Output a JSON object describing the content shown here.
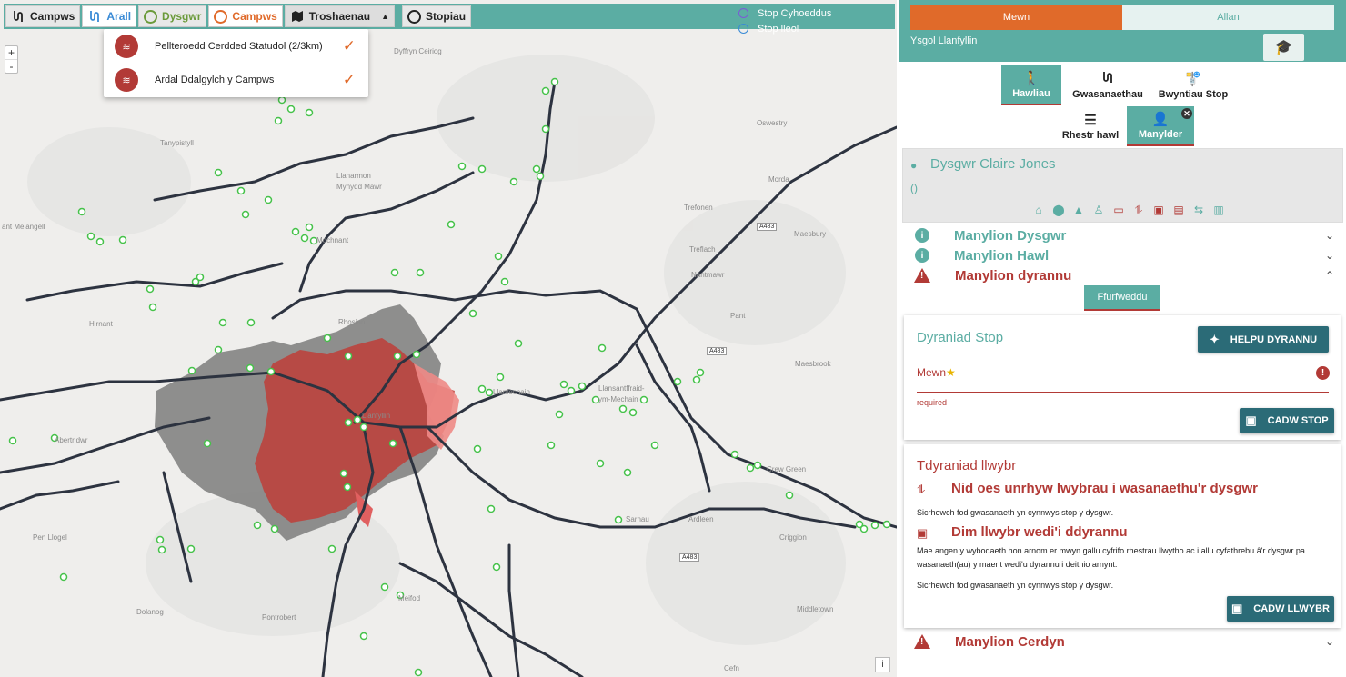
{
  "toolbar": {
    "campws": "Campws",
    "arall": "Arall",
    "dysgwr": "Dysgwr",
    "campws2": "Campws",
    "troshaenau": "Troshaenau",
    "stopiau": "Stopiau"
  },
  "legend": {
    "public": "Stop Cyhoeddus",
    "local": "Stop lleol",
    "public_color": "#7b5bd6",
    "local_color": "#3a8bd6"
  },
  "dropdown": {
    "item1": "Pellteroedd Cerdded Statudol (2/3km)",
    "item2": "Ardal Ddalgylch y Campws"
  },
  "map": {
    "zoom_in": "+",
    "zoom_out": "-",
    "attribution": "i",
    "places": [
      "Dyffryn Ceiriog",
      "Tanypistyll",
      "Oswestry",
      "Llanarmon Mynydd Mawr",
      "Morda",
      "ant Melangell",
      "Trefonen",
      "Maesbury",
      "Mochnant",
      "Treflach",
      "Nantmawr",
      "Hirnant",
      "Rhosian",
      "Pant",
      "Llanfyllin",
      "Maesbrook",
      "Llansantffraid-ym-Mechain",
      "Abertridwr",
      "Llanfechain",
      "Pen Llogel",
      "Sarnau",
      "Ardleen",
      "Crew Green",
      "Criggion",
      "Meifod",
      "Dolanog",
      "Pontrobert",
      "Middletown",
      "Cefn"
    ],
    "roads": [
      "A483",
      "A483",
      "A483"
    ]
  },
  "panel": {
    "in_label": "Mewn",
    "out_label": "Allan",
    "school": "Ysgol Llanfyllin",
    "tabs": {
      "hawliau": "Hawliau",
      "gwasanaethau": "Gwasanaethau",
      "bwyntiau": "Bwyntiau Stop",
      "rhestr": "Rhestr hawl",
      "manylder": "Manylder"
    },
    "learner_name": "Dysgwr Claire Jones",
    "learner_sub": "()",
    "acc": {
      "dysgwr": "Manylion Dysgwr",
      "hawl": "Manylion Hawl",
      "dyrannu": "Manylion dyrannu",
      "cerdyn": "Manylion Cerdyn"
    },
    "ffurfweddu": "Ffurfweddu",
    "card1": {
      "title": "Dyraniad Stop",
      "help_btn": "HELPU DYRANNU",
      "field_label": "Mewn",
      "required": "required",
      "save_btn": "CADW STOP"
    },
    "card2": {
      "title": "Tdyraniad llwybr",
      "h1": "Nid oes unrhyw lwybrau i wasanaethu'r dysgwr",
      "p1": "Sicrhewch fod gwasanaeth yn cynnwys stop y dysgwr.",
      "h2": "Dim llwybr wedi'i ddyrannu",
      "p2": "Mae angen y wybodaeth hon arnom er mwyn gallu cyfrifo rhestrau llwytho ac i allu cyfathrebu â'r dysgwr pa wasanaeth(au) y maent wedi'u dyrannu i deithio arnynt.",
      "p3": "Sicrhewch fod gwasanaeth yn cynnwys stop y dysgwr.",
      "save_btn": "CADW LLWYBR"
    }
  },
  "colors": {
    "teal": "#5bada3",
    "orange": "#e06a2a",
    "red": "#b23a36",
    "dark": "#2b6b77"
  }
}
